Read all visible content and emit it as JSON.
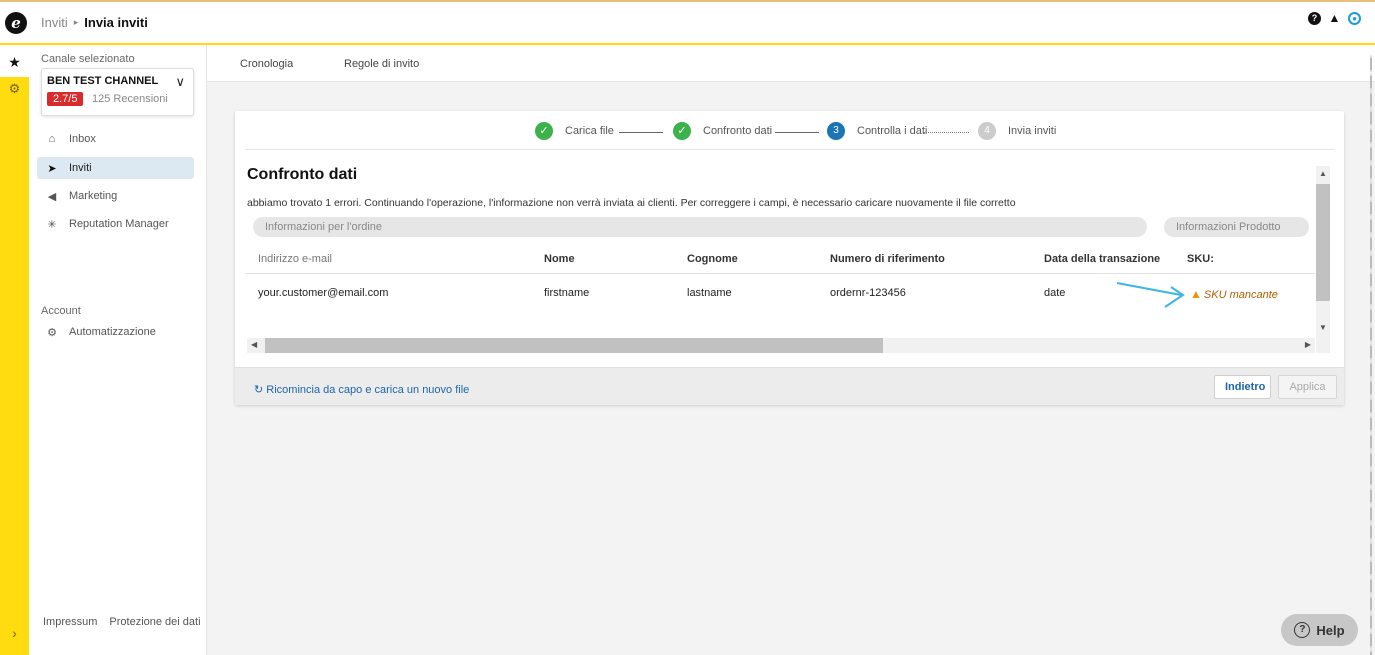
{
  "header": {
    "logo": "e",
    "breadcrumb_root": "Inviti",
    "breadcrumb_sep": "▸",
    "breadcrumb_current": "Invia inviti",
    "help_glyph": "?",
    "bell_glyph": "🔔",
    "user_glyph": "●"
  },
  "rail": {
    "star": "★",
    "gear": "⚙",
    "expand": "›"
  },
  "sidebar": {
    "channel_label": "Canale selezionato",
    "channel_name": "BEN TEST CHANNEL",
    "channel_chevron": "∨",
    "rating": "2.7/5",
    "reviews": "125 Recensioni",
    "nav": [
      {
        "label": "Inbox",
        "icon": "⌂"
      },
      {
        "label": "Inviti",
        "icon": "➤"
      },
      {
        "label": "Marketing",
        "icon": "◀"
      },
      {
        "label": "Reputation Manager",
        "icon": "✳"
      }
    ],
    "account_label": "Account",
    "account_nav": [
      {
        "label": "Automatizzazione",
        "icon": "⚙"
      }
    ],
    "footer": {
      "impressum": "Impressum",
      "privacy": "Protezione dei dati"
    }
  },
  "tabs": [
    "Cronologia",
    "Regole di invito"
  ],
  "stepper": [
    {
      "label": "Carica file",
      "marker": "✓",
      "state": "done"
    },
    {
      "label": "Confronto dati",
      "marker": "✓",
      "state": "done"
    },
    {
      "label": "Controlla i dati",
      "marker": "3",
      "state": "current"
    },
    {
      "label": "Invia inviti",
      "marker": "4",
      "state": "todo"
    }
  ],
  "card": {
    "title": "Confronto dati",
    "description": "abbiamo trovato 1 errori. Continuando l'operazione, l'informazione non verrà inviata ai clienti. Per correggere i campi, è necessario caricare nuovamente il file corretto",
    "groups": [
      "Informazioni per l'ordine",
      "Informazioni Prodotto"
    ],
    "columns": [
      "Indirizzo e-mail",
      "Nome",
      "Cognome",
      "Numero di riferimento",
      "Data della transazione",
      "SKU:"
    ],
    "row": [
      "your.customer@email.com",
      "firstname",
      "lastname",
      "ordernr-123456",
      "date",
      "SKU mancante"
    ],
    "warning_glyph": "▲",
    "restart_icon": "↻",
    "restart_link": "Ricomincia da capo e carica un nuovo file",
    "back_button": "Indietro",
    "apply_button": "Applica"
  },
  "scroll": {
    "up": "▲",
    "down": "▼",
    "left": "◀",
    "right": "▶"
  },
  "help": {
    "label": "Help",
    "glyph": "?"
  },
  "colors": {
    "accent_yellow": "#ffdc0f",
    "link_blue": "#1c66a8",
    "step_done": "#3bb34a",
    "step_current": "#1c74b8",
    "rating_red": "#d92b2b",
    "warning": "#f29200"
  }
}
